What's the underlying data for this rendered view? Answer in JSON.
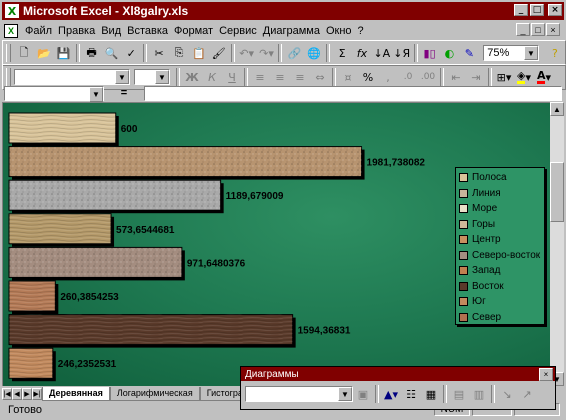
{
  "window": {
    "title": "Microsoft Excel - Xl8galry.xls",
    "app_icon": "X",
    "buttons": [
      "_",
      "□",
      "×"
    ]
  },
  "menu": {
    "items": [
      "Файл",
      "Правка",
      "Вид",
      "Вставка",
      "Формат",
      "Сервис",
      "Диаграмма",
      "Окно",
      "?"
    ],
    "doc_buttons": [
      "_",
      "□",
      "×"
    ]
  },
  "toolbar_standard": {
    "zoom": "75%",
    "icons": [
      "new-icon",
      "open-icon",
      "save-icon",
      "print-icon",
      "preview-icon",
      "spell-icon",
      "cut-icon",
      "copy-icon",
      "paste-icon",
      "format-painter-icon",
      "undo-icon",
      "redo-icon",
      "hyperlink-icon",
      "web-icon",
      "autosum-icon",
      "function-icon",
      "sort-asc-icon",
      "sort-desc-icon",
      "chart-wizard-icon",
      "map-icon",
      "drawing-icon",
      "zoom-combo",
      "help-icon"
    ]
  },
  "toolbar_format": {
    "font_name": "",
    "font_size": "",
    "bold": "Ж",
    "italic": "К",
    "underline": "Ч",
    "percent": "%",
    "comma": ",",
    "fill_color": "#ffff00",
    "font_color": "#ff0000"
  },
  "formula_bar": {
    "name_box": "",
    "equals": "=",
    "value": ""
  },
  "chart_data": {
    "type": "bar",
    "orientation": "horizontal",
    "bar_fill": "texture",
    "bars": [
      {
        "value": 600,
        "label": "600",
        "texture": "#d9c49a"
      },
      {
        "value": 1981.738082,
        "label": "1981,738082",
        "texture": "#b79470"
      },
      {
        "value": 1189.679009,
        "label": "1189,679009",
        "texture": "#a9a9a9"
      },
      {
        "value": 573.6544681,
        "label": "573,6544681",
        "texture": "#b59a6a"
      },
      {
        "value": 971.6480376,
        "label": "971,6480376",
        "texture": "#a48d80"
      },
      {
        "value": 260.3854253,
        "label": "260,3854253",
        "texture": "#b57b57"
      },
      {
        "value": 1594.36831,
        "label": "1594,36831",
        "texture": "#5a3a2a"
      },
      {
        "value": 246.2352531,
        "label": "246,2352531",
        "texture": "#c28a5e"
      }
    ],
    "legend": {
      "placement": "right",
      "entries": [
        {
          "label": "Полоса",
          "color": "#d9c49a"
        },
        {
          "label": "Линия",
          "color": "#c8b49a"
        },
        {
          "label": "Море",
          "color": "#e8e0c8"
        },
        {
          "label": "Горы",
          "color": "#d0b898"
        },
        {
          "label": "Центр",
          "color": "#c89060"
        },
        {
          "label": "Северо-восток",
          "color": "#a48d80"
        },
        {
          "label": "Запад",
          "color": "#c08050"
        },
        {
          "label": "Восток",
          "color": "#5a3a2a"
        },
        {
          "label": "Юг",
          "color": "#c28a5e"
        },
        {
          "label": "Север",
          "color": "#b07050"
        }
      ]
    },
    "background": "#1f7a52"
  },
  "sheet_tabs": {
    "tabs": [
      "Деревянная",
      "Логарифмическая",
      "Гистограмма"
    ],
    "active": "Деревянная"
  },
  "status_bar": {
    "text": "Готово",
    "indicator": "NUM"
  },
  "floating_toolbar": {
    "title": "Диаграммы",
    "close": "×"
  }
}
